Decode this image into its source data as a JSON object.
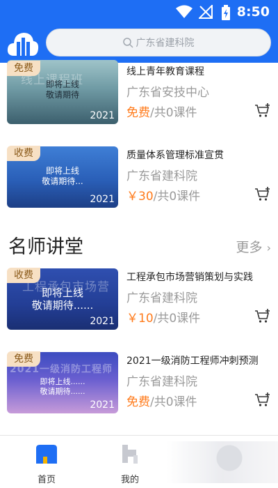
{
  "status": {
    "time": "8:50"
  },
  "search": {
    "placeholder": "广东省建科院"
  },
  "courses_top": [
    {
      "badge": "免费",
      "title": "线上青年教育课程",
      "org": "广东省安技中心",
      "price": "免费",
      "count": "/共0课件",
      "thumb_ghost": "线上课程班",
      "thumb_soon": "即将上线\n敬请期待",
      "thumb_year": "2021"
    },
    {
      "badge": "收费",
      "title": "质量体系管理标准宣贯",
      "org": "广东省建科院",
      "price": "￥30",
      "count": "/共0课件",
      "thumb_ghost": "",
      "thumb_soon": "即将上线\n敬请期待...",
      "thumb_year": "2021"
    }
  ],
  "section": {
    "title": "名师讲堂",
    "more": "更多"
  },
  "courses_bottom": [
    {
      "badge": "收费",
      "title": "工程承包市场营销策划与实践",
      "org": "广东省建科院",
      "price": "￥10",
      "count": "/共0课件",
      "thumb_ghost": "工程承包市场营",
      "thumb_soon": "即将上线\n敬请期待......",
      "thumb_year": "2021"
    },
    {
      "badge": "免费",
      "title": "2021一级消防工程师冲刺预测",
      "org": "广东省建科院",
      "price": "免费",
      "count": "/共0课件",
      "thumb_ghost": "2021一级消防工程师",
      "thumb_soon": "即将上线......\n敬请期待......",
      "thumb_year": "2021"
    }
  ],
  "tabs": [
    {
      "label": "首页",
      "icon": "home-icon"
    },
    {
      "label": "我的",
      "icon": "user-icon"
    }
  ],
  "colors": {
    "brand": "#1e6ef4",
    "price": "#ff7a1a",
    "badge_bg": "#f7e0c4"
  }
}
